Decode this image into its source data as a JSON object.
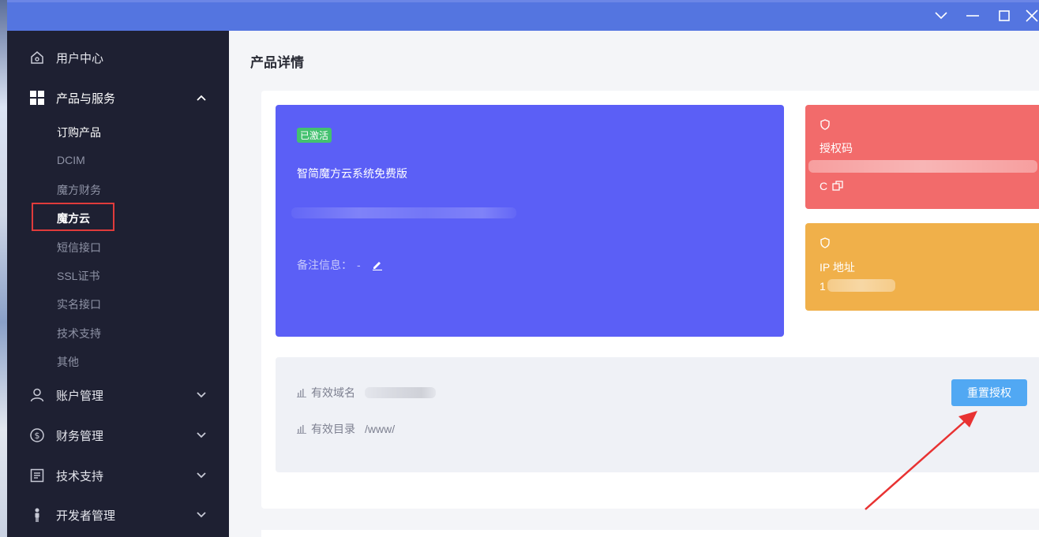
{
  "window": {
    "controls": [
      "chevron-down",
      "minimize",
      "maximize",
      "close"
    ]
  },
  "sidebar": {
    "items": [
      {
        "label": "用户中心",
        "icon": "home-icon"
      },
      {
        "label": "产品与服务",
        "icon": "grid-icon",
        "expanded": true
      },
      {
        "label": "账户管理",
        "icon": "user-icon"
      },
      {
        "label": "财务管理",
        "icon": "dollar-icon"
      },
      {
        "label": "技术支持",
        "icon": "document-icon"
      },
      {
        "label": "开发者管理",
        "icon": "developer-icon"
      }
    ],
    "sub_items": [
      "订购产品",
      "DCIM",
      "魔方财务",
      "魔方云",
      "短信接口",
      "SSL证书",
      "实名接口",
      "技术支持",
      "其他"
    ],
    "active_sub_item": "魔方云"
  },
  "main": {
    "title": "产品详情",
    "product": {
      "status_badge": "已激活",
      "name": "智简魔方云系统免费版",
      "remark_label": "备注信息：",
      "remark_value": "-"
    },
    "auth_card": {
      "label": "授权码",
      "code_prefix": "C"
    },
    "ip_card": {
      "label": "IP 地址",
      "ip_prefix": "1"
    },
    "info": {
      "domain_label": "有效域名",
      "dir_label": "有效目录",
      "dir_value": "/www/",
      "reset_button": "重置授权"
    }
  },
  "colors": {
    "titlebar": "#5475e0",
    "sidebar": "#1e2032",
    "product_card": "#5b5ff6",
    "auth_card": "#f26b6b",
    "ip_card": "#f0b04a",
    "badge": "#43c16f",
    "reset_button": "#51a8f3",
    "highlight": "#e03b3b"
  }
}
